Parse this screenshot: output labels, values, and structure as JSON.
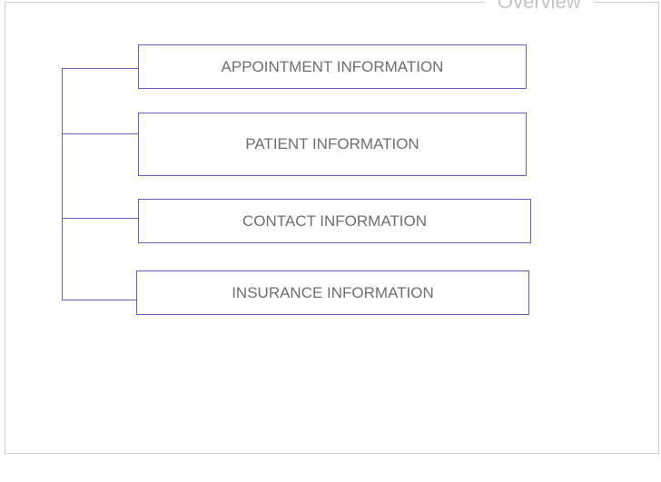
{
  "legend": "Overview",
  "colors": {
    "connector": "#6a5acd",
    "box_border": "#6a5acd",
    "label": "#6f6f6f",
    "legend": "#c4c4c4",
    "frame": "#cfcfcf"
  },
  "sections": [
    {
      "label": "APPOINTMENT INFORMATION"
    },
    {
      "label": "PATIENT INFORMATION"
    },
    {
      "label": "CONTACT INFORMATION"
    },
    {
      "label": "INSURANCE INFORMATION"
    }
  ]
}
